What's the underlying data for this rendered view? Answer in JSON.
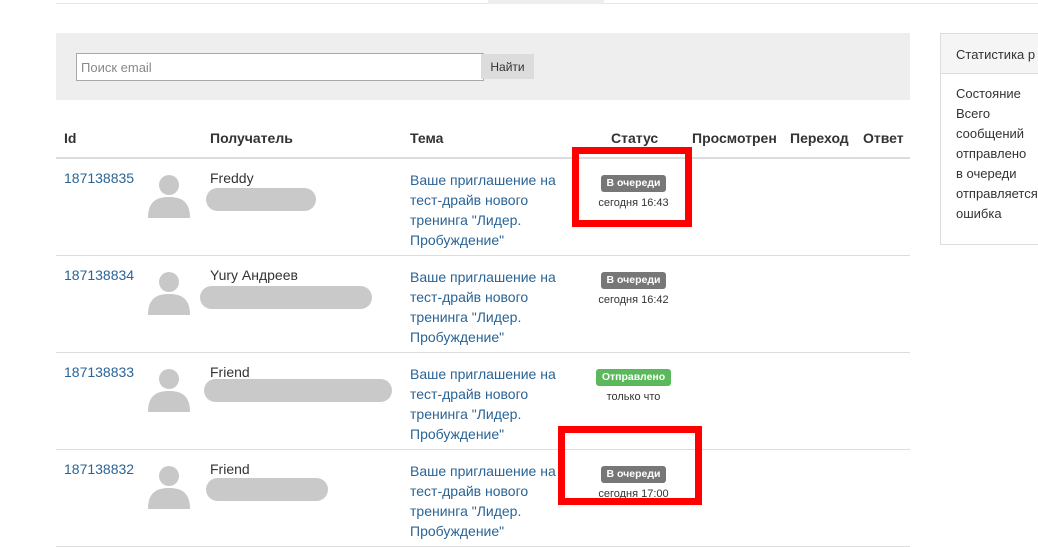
{
  "search": {
    "placeholder": "Поиск email",
    "value": "",
    "button_label": "Найти"
  },
  "table": {
    "headers": {
      "id": "Id",
      "recipient": "Получатель",
      "subject": "Тема",
      "status": "Статус",
      "viewed": "Просмотрен",
      "click": "Переход",
      "reply": "Ответ"
    },
    "rows": [
      {
        "id": "187138835",
        "name": "Freddy",
        "subject": "Ваше приглашение на тест-драйв нового тренинга \"Лидер. Пробуждение\"",
        "status": "В очереди",
        "status_kind": "queue",
        "time": "сегодня 16:43"
      },
      {
        "id": "187138834",
        "name": "Yury Андреев",
        "subject": "Ваше приглашение на тест-драйв нового тренинга \"Лидер. Пробуждение\"",
        "status": "В очереди",
        "status_kind": "queue",
        "time": "сегодня 16:42"
      },
      {
        "id": "187138833",
        "name": "Friend",
        "subject": "Ваше приглашение на тест-драйв нового тренинга \"Лидер. Пробуждение\"",
        "status": "Отправлено",
        "status_kind": "sent",
        "time": "только что"
      },
      {
        "id": "187138832",
        "name": "Friend",
        "subject": "Ваше приглашение на тест-драйв нового тренинга \"Лидер. Пробуждение\"",
        "status": "В очереди",
        "status_kind": "queue",
        "time": "сегодня 17:00"
      }
    ]
  },
  "side_panel": {
    "title": "Статистика р",
    "lines": [
      "Состояние",
      "Всего",
      "сообщений",
      "отправлено",
      "в очереди",
      "отправляется",
      "ошибка"
    ]
  },
  "colors": {
    "link": "#2a6496",
    "queue_badge": "#777777",
    "sent_badge": "#5cb85c",
    "highlight": "#ff0000"
  }
}
